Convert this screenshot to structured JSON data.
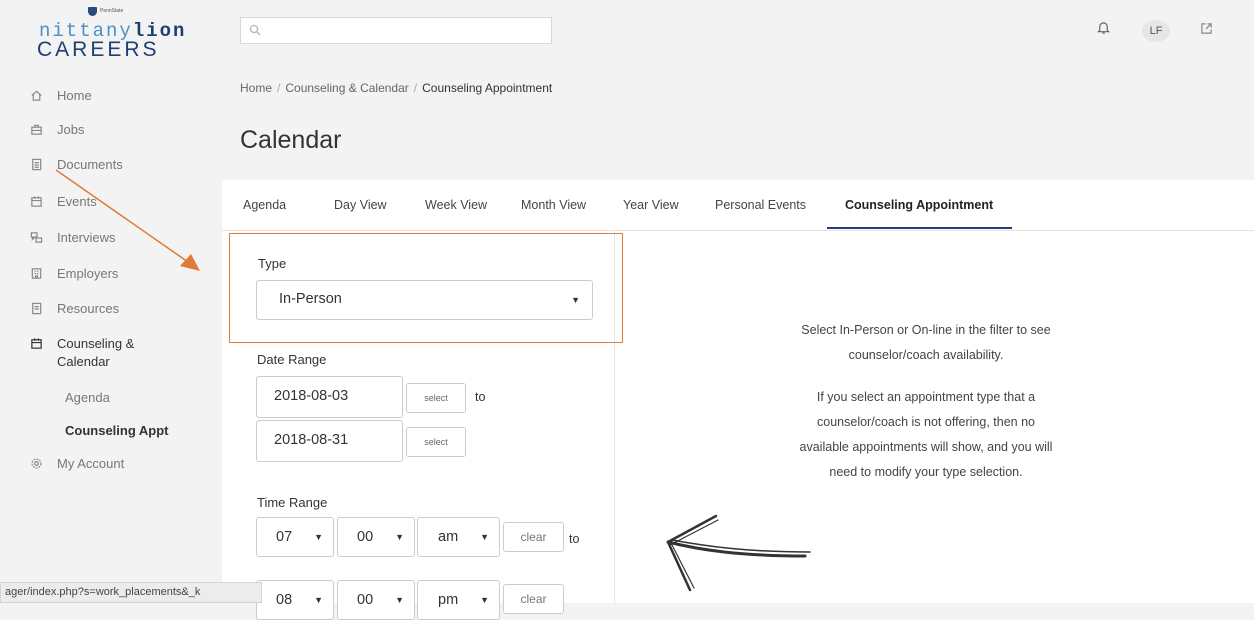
{
  "logo": {
    "tiny_text": "PennState",
    "line1_a": "nittany",
    "line1_b": "lion",
    "line2": "CAREERS"
  },
  "nav": {
    "items": [
      {
        "label": "Home",
        "icon": "home-icon"
      },
      {
        "label": "Jobs",
        "icon": "briefcase-icon"
      },
      {
        "label": "Documents",
        "icon": "document-icon"
      },
      {
        "label": "Events",
        "icon": "calendar-icon"
      },
      {
        "label": "Interviews",
        "icon": "interviews-icon"
      },
      {
        "label": "Employers",
        "icon": "building-icon"
      },
      {
        "label": "Resources",
        "icon": "resources-icon"
      },
      {
        "label": "Counseling & Calendar",
        "icon": "calendar-icon"
      },
      {
        "label": "My Account",
        "icon": "gear-icon"
      }
    ],
    "counseling_line1": "Counseling &",
    "counseling_line2": "Calendar",
    "sub_items": [
      {
        "label": "Agenda",
        "active": false
      },
      {
        "label": "Counseling Appt",
        "active": true
      }
    ]
  },
  "header": {
    "search_placeholder": "",
    "avatar_initials": "LF"
  },
  "breadcrumb": {
    "home": "Home",
    "sep": "/",
    "level1": "Counseling & Calendar",
    "current": "Counseling Appointment"
  },
  "page_title": "Calendar",
  "tabs": [
    {
      "label": "Agenda"
    },
    {
      "label": "Day View"
    },
    {
      "label": "Week View"
    },
    {
      "label": "Month View"
    },
    {
      "label": "Year View"
    },
    {
      "label": "Personal Events"
    },
    {
      "label": "Counseling Appointment",
      "active": true
    }
  ],
  "form": {
    "type_label": "Type",
    "type_value": "In-Person",
    "date_range_label": "Date Range",
    "date_start": "2018-08-03",
    "date_end": "2018-08-31",
    "select_label": "select",
    "to_label": "to",
    "time_range_label": "Time Range",
    "time_start": {
      "hour": "07",
      "minute": "00",
      "ampm": "am"
    },
    "time_end": {
      "hour": "08",
      "minute": "00",
      "ampm": "pm"
    },
    "clear_label": "clear"
  },
  "info": {
    "line1": "Select In-Person or On-line in the filter to see",
    "line2": "counselor/coach availability.",
    "line3": "If you select an appointment type that a",
    "line4": "counselor/coach is not offering, then no",
    "line5": "available appointments will show, and you will",
    "line6": "need to modify your type selection."
  },
  "status_url": "ager/index.php?s=work_placements&_k",
  "colors": {
    "accent": "#2e3a6e",
    "annotation": "#e07b39",
    "brand_dark": "#1f3f73",
    "brand_light": "#4c8fc9"
  }
}
